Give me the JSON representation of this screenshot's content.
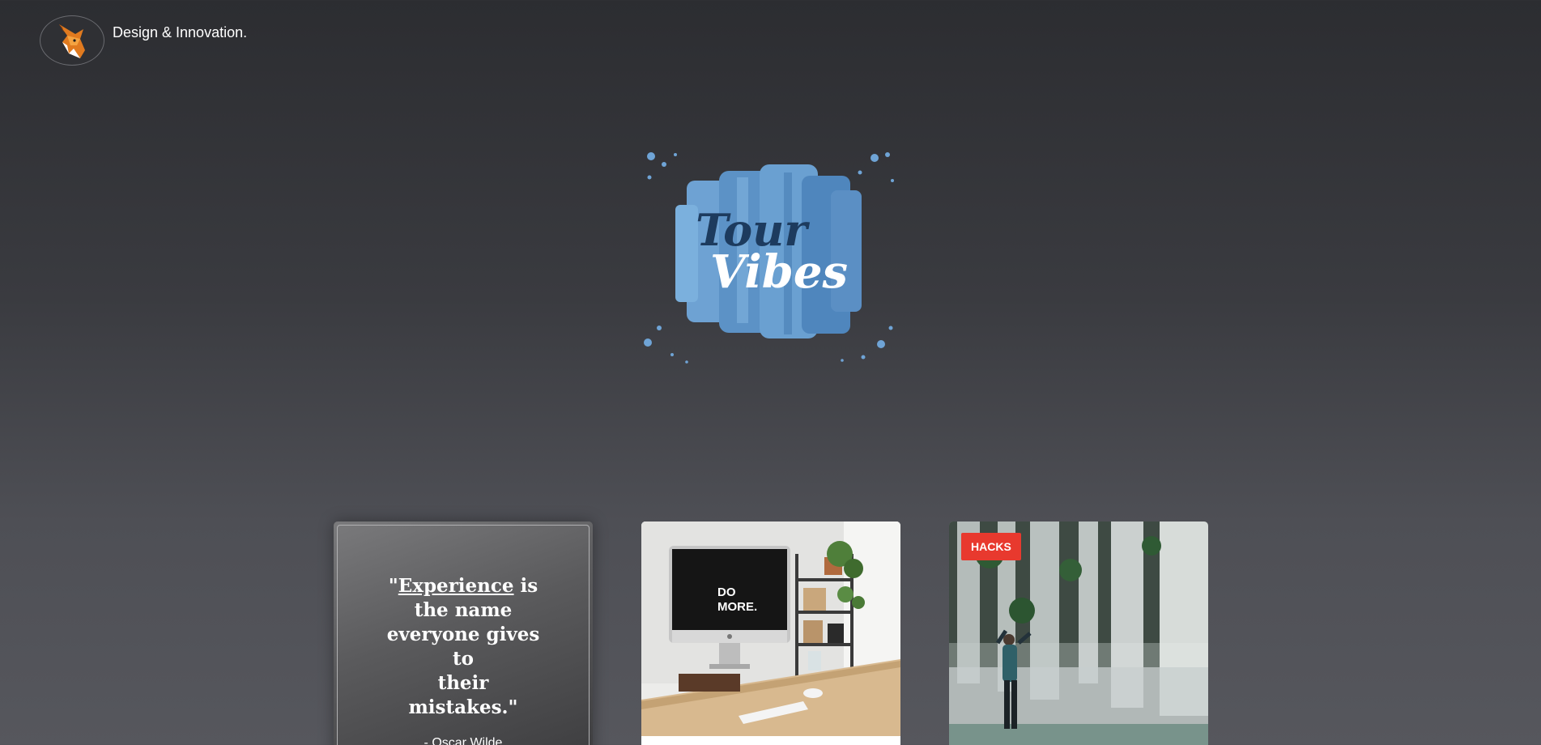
{
  "header": {
    "brand": "Design & Innovation.",
    "logo_icon": "fox-logo-icon"
  },
  "hero": {
    "logo_text_line1": "Tour",
    "logo_text_line2": "Vibes",
    "accent_color": "#5b93c7"
  },
  "cards": {
    "quote": {
      "word_underlined": "Experience",
      "text_rest_line1": " is",
      "text_line2": "the name",
      "text_line3": "everyone gives to",
      "text_line4": "their mistakes.\"",
      "open_quote": "\"",
      "author": "- Oscar Wilde"
    },
    "photo": {
      "screen_text_line1": "DO",
      "screen_text_line2": "MORE."
    },
    "hacks": {
      "badge": "HACKS",
      "badge_color": "#e8392e"
    }
  }
}
